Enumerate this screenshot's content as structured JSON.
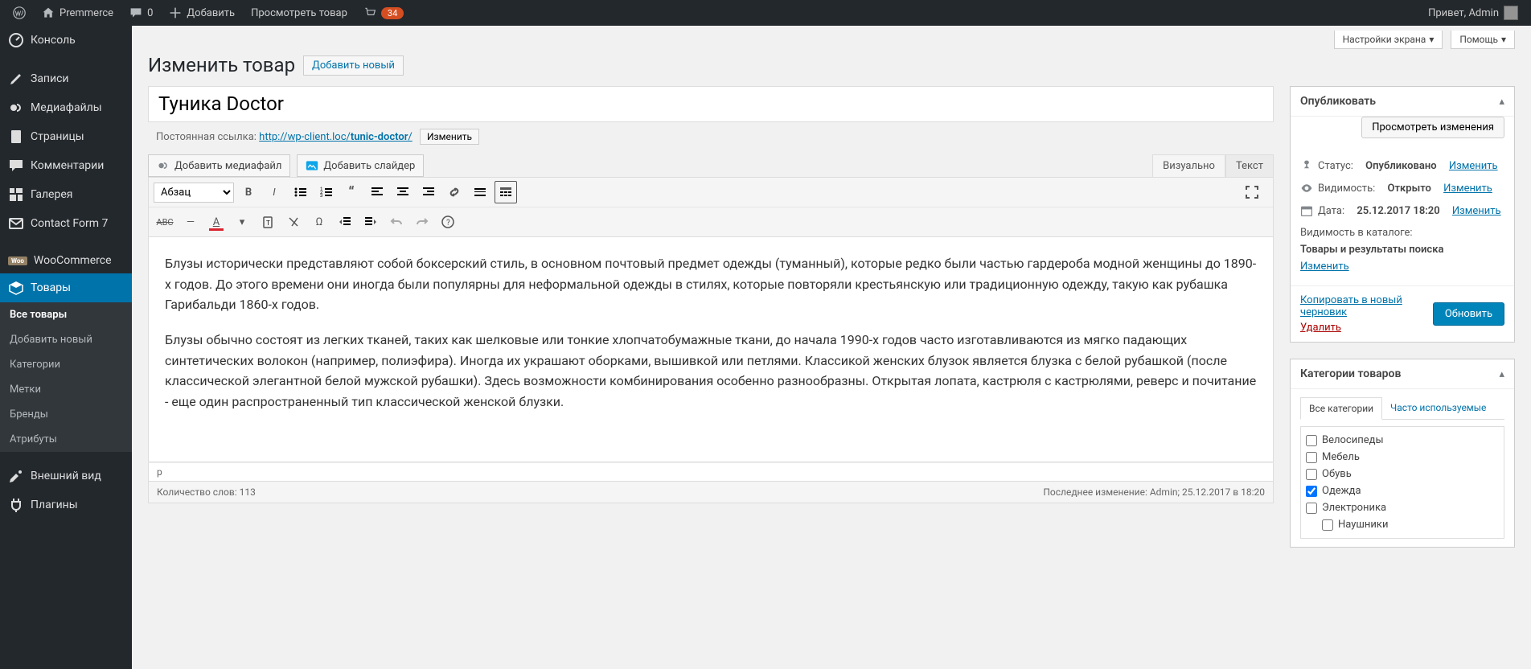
{
  "adminbar": {
    "site": "Premmerce",
    "comments": "0",
    "add": "Добавить",
    "view": "Просмотреть товар",
    "notif": "34",
    "greeting": "Привет, Admin"
  },
  "sidebar": {
    "items": [
      {
        "label": "Консоль"
      },
      {
        "label": "Записи"
      },
      {
        "label": "Медиафайлы"
      },
      {
        "label": "Страницы"
      },
      {
        "label": "Комментарии"
      },
      {
        "label": "Галерея"
      },
      {
        "label": "Contact Form 7"
      },
      {
        "label": "WooCommerce"
      },
      {
        "label": "Товары"
      },
      {
        "label": "Внешний вид"
      },
      {
        "label": "Плагины"
      }
    ],
    "sub": [
      "Все товары",
      "Добавить новый",
      "Категории",
      "Метки",
      "Бренды",
      "Атрибуты"
    ]
  },
  "screen": {
    "options": "Настройки экрана",
    "help": "Помощь"
  },
  "header": {
    "title": "Изменить товар",
    "addnew": "Добавить новый"
  },
  "title_value": "Туника Doctor",
  "permalink": {
    "label": "Постоянная ссылка:",
    "base": "http://wp-client.loc/",
    "slug": "tunic-doctor",
    "end": "/",
    "edit": "Изменить"
  },
  "media": {
    "add": "Добавить медиафайл",
    "slider": "Добавить слайдер"
  },
  "tabs": {
    "visual": "Визуально",
    "text": "Текст"
  },
  "format": "Абзац",
  "content": {
    "p1": "Блузы исторически представляют собой боксерский стиль, в основном почтовый предмет одежды (туманный), которые редко были частью гардероба модной женщины до 1890-х годов. До этого времени они иногда были популярны для неформальной одежды в стилях, которые повторяли крестьянскую или традиционную одежду, такую как рубашка Гарибальди 1860-х годов.",
    "p2": "Блузы обычно состоят из легких тканей, таких как шелковые или тонкие хлопчатобумажные ткани, до начала 1990-х годов часто изготавливаются из мягко падающих синтетических волокон (например, полиэфира). Иногда их украшают оборками, вышивкой или петлями. Классикой женских блузок является блузка с белой рубашкой (после классической элегантной белой мужской рубашки). Здесь возможности комбинирования особенно разнообразны. Открытая лопата, кастрюля с кастрюлями, реверс и почитание - еще один распространенный тип классической женской блузки."
  },
  "statusbar": "p",
  "footer": {
    "words": "Количество слов: 113",
    "revision": "Последнее изменение: Admin; 25.12.2017 в 18:20"
  },
  "publish": {
    "header": "Опубликовать",
    "preview": "Просмотреть изменения",
    "status_label": "Статус:",
    "status_value": "Опубликовано",
    "vis_label": "Видимость:",
    "vis_value": "Открыто",
    "date_label": "Дата:",
    "date_value": "25.12.2017 18:20",
    "catvis_label": "Видимость в каталоге:",
    "catvis_value": "Товары и результаты поиска",
    "edit": "Изменить",
    "copy": "Копировать в новый черновик",
    "trash": "Удалить",
    "update": "Обновить"
  },
  "cats": {
    "header": "Категории товаров",
    "tab_all": "Все категории",
    "tab_used": "Часто используемые",
    "items": [
      {
        "label": "Велосипеды",
        "checked": false,
        "indent": false
      },
      {
        "label": "Мебель",
        "checked": false,
        "indent": false
      },
      {
        "label": "Обувь",
        "checked": false,
        "indent": false
      },
      {
        "label": "Одежда",
        "checked": true,
        "indent": false
      },
      {
        "label": "Электроника",
        "checked": false,
        "indent": false
      },
      {
        "label": "Наушники",
        "checked": false,
        "indent": true
      }
    ]
  }
}
